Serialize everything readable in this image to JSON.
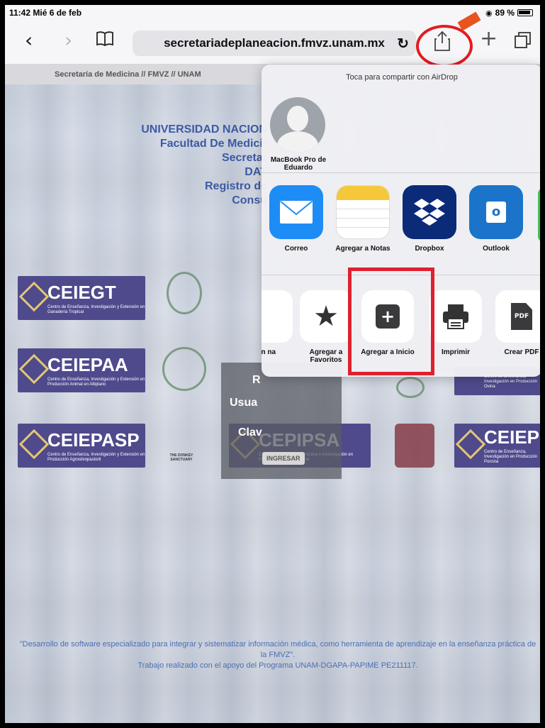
{
  "status_bar": {
    "time_date": "11:42  Mié 6 de feb",
    "battery": "89 %"
  },
  "toolbar": {
    "url": "secretariadeplaneacion.fmvz.unam.mx"
  },
  "page": {
    "header_bar": "Secretaría de Medicina // FMVZ // UNAM",
    "lines": [
      "UNIVERSIDAD NACION",
      "Facultad De Medicir",
      "Secretar",
      "DAT",
      "Registro de",
      "Consu"
    ],
    "logos": [
      {
        "name": "CEIEGT",
        "sub": "Centro de Enseñanza, Investigación y Extensión en Ganadería Tropical"
      },
      {
        "name": "CEIEPAA",
        "sub": "Centro de Enseñanza, Investigación y Extensión en Producción Animal en Altiplano"
      },
      {
        "name": "CEIEPASP",
        "sub": "Centro de Enseñanza, Investigación y Extensión en Producción Agrosilvopastoril"
      },
      {
        "name": "CEPIPSA",
        "sub": "Centro de Enseñanza, Práctica e Investigación en Producción y Salud Animal"
      },
      {
        "name": "CEIEP",
        "sub": "Centro de Enseñanza, Investigación en Producción Porcina"
      },
      {
        "name": "",
        "sub": "Centro de Enseñanza, Investigación en Producción Ovina"
      }
    ],
    "donkey_label": "THE DONKEY SANCTUARY",
    "login": {
      "r": "R",
      "user": "Usua",
      "pass": "Clav",
      "button": "INGRESAR"
    },
    "footer_line1": "\"Desarrollo de software especializado para integrar y sistematizar información médica, como herramienta de aprendizaje en la enseñanza práctica de la FMVZ\".",
    "footer_line2": "Trabajo realizado con el apoyo del Programa UNAM-DGAPA-PAPIME PE211117."
  },
  "share_sheet": {
    "airdrop_title": "Toca para compartir con AirDrop",
    "airdrop_person": "MacBook Pro de Eduardo",
    "apps": [
      {
        "label": "Correo",
        "color": "#1e8cf5",
        "icon": "mail-icon"
      },
      {
        "label": "Agregar a Notas",
        "color": "#ffffff",
        "icon": "notes-icon"
      },
      {
        "label": "Dropbox",
        "color": "#0b2a78",
        "icon": "dropbox-icon"
      },
      {
        "label": "Outlook",
        "color": "#1b74c9",
        "icon": "outlook-icon"
      }
    ],
    "actions": [
      {
        "label": "en na",
        "icon": "partial-icon"
      },
      {
        "label": "Agregar a Favoritos",
        "icon": "star-icon"
      },
      {
        "label": "Agregar a Inicio",
        "icon": "add-home-icon"
      },
      {
        "label": "Imprimir",
        "icon": "print-icon"
      },
      {
        "label": "Crear PDF",
        "icon": "pdf-icon"
      }
    ],
    "pdf_glyph": "PDF",
    "outlook_glyph": "o"
  },
  "annotations": {
    "circle_color": "#e21c22",
    "box_color": "#e0202e"
  }
}
